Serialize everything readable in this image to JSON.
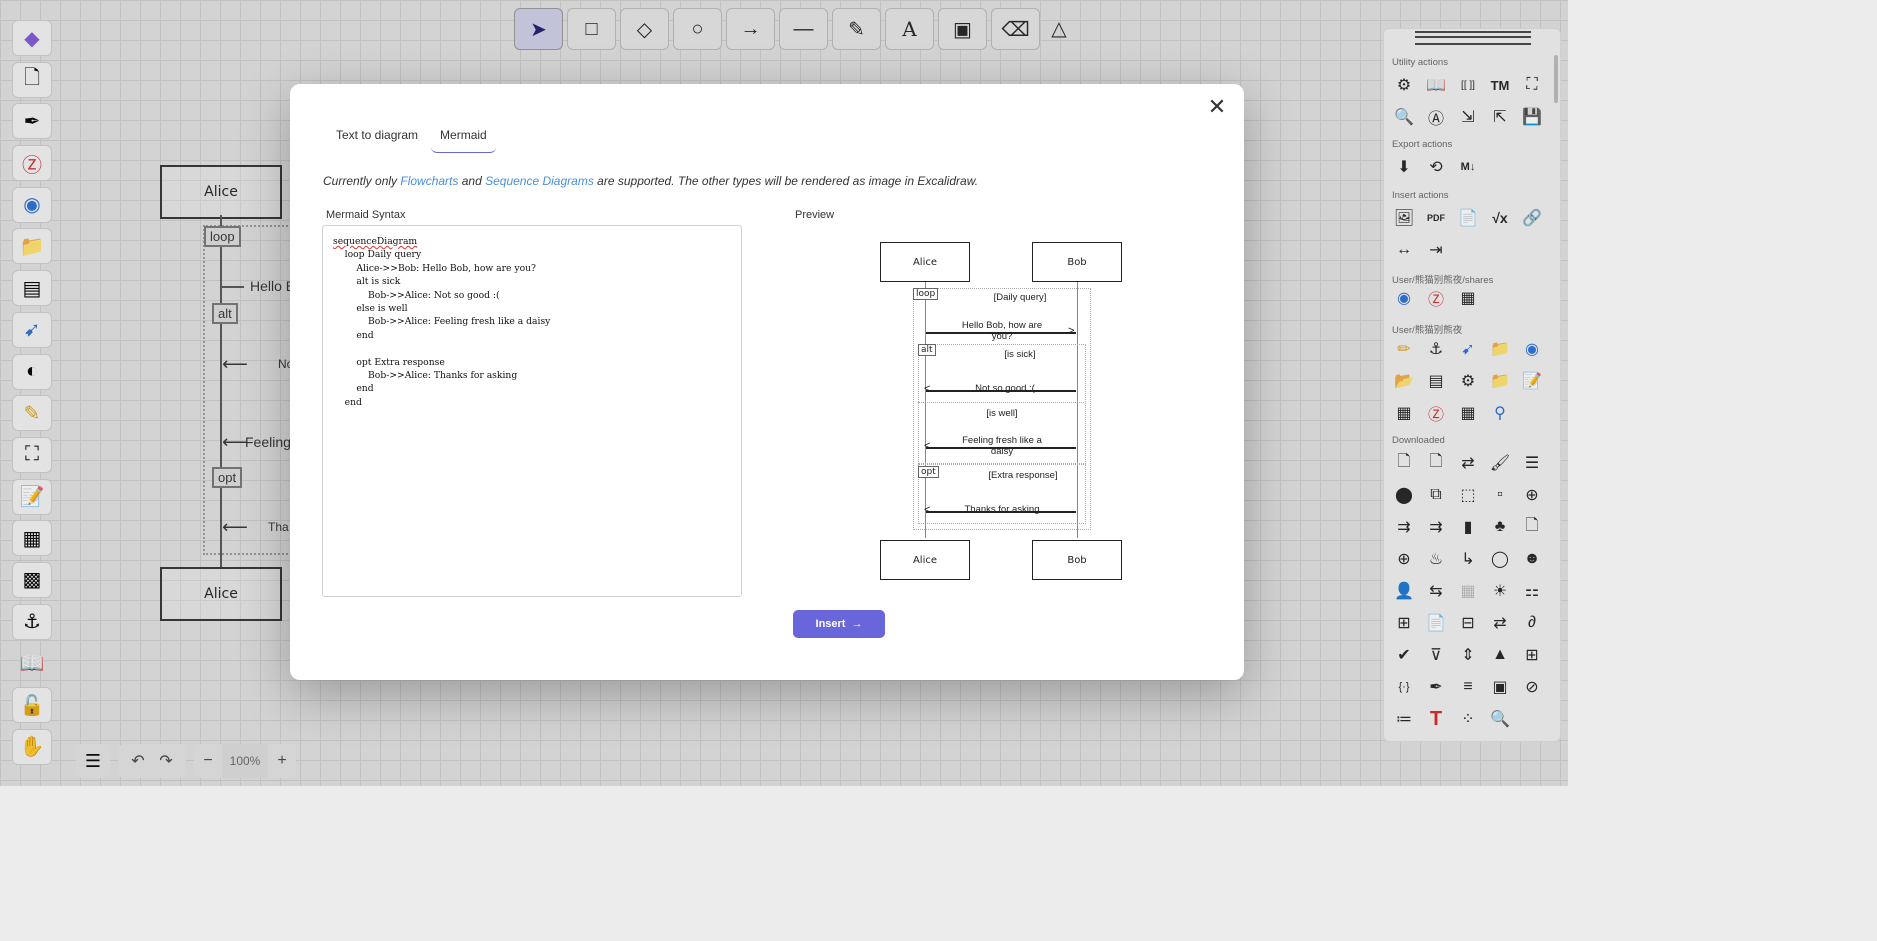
{
  "toolbar": {
    "tools": [
      {
        "name": "selection-tool",
        "glyph": "➤"
      },
      {
        "name": "rectangle-tool",
        "glyph": "□"
      },
      {
        "name": "diamond-tool",
        "glyph": "◇"
      },
      {
        "name": "ellipse-tool",
        "glyph": "○"
      },
      {
        "name": "arrow-tool",
        "glyph": "→"
      },
      {
        "name": "line-tool",
        "glyph": "—"
      },
      {
        "name": "draw-tool",
        "glyph": "✎"
      },
      {
        "name": "text-tool",
        "glyph": "A"
      },
      {
        "name": "image-tool",
        "glyph": "▣"
      },
      {
        "name": "eraser-tool",
        "glyph": "⌫"
      }
    ],
    "more_glyph": "△"
  },
  "bottom": {
    "menu_glyph": "☰",
    "undo_glyph": "↶",
    "redo_glyph": "↷",
    "zoom_out": "−",
    "zoom_value": "100%",
    "zoom_in": "+"
  },
  "background": {
    "actor_top": "Alice",
    "actor_bottom": "Alice",
    "loop_tag": "loop",
    "alt_tag": "alt",
    "opt_tag": "opt",
    "msg1": "Hello B",
    "msg2": "No",
    "msg3": "Feeling",
    "msg4": "Tha"
  },
  "right_panel": {
    "sections": {
      "utility": "Utility actions",
      "export": "Export actions",
      "insert": "Insert actions",
      "user_shares": "User/熊猫别熊夜/shares",
      "user": "User/熊猫别熊夜",
      "downloaded": "Downloaded"
    },
    "utility_icons": [
      "gear-icon",
      "book-icon",
      "brackets-icon",
      "tm-icon",
      "fullscreen-icon",
      "search-icon",
      "ocr-icon",
      "import-icon",
      "export-file-icon",
      "save-icon"
    ],
    "utility_glyphs": [
      "⚙",
      "📖",
      "[[ ]]",
      "TM",
      "⛶",
      "🔍",
      "Ⓐ",
      "⇲",
      "⇱",
      "💾"
    ],
    "export_glyphs": [
      "⬇",
      "⟲",
      "M↓"
    ],
    "insert_glyphs": [
      "🖼",
      "PDF",
      "📄",
      "√x",
      "🔗",
      "↔",
      "⇥"
    ],
    "shares_glyphs": [
      "◉",
      "Ⓩ",
      "▦"
    ],
    "user_glyphs": [
      "✏",
      "⚓",
      "➹",
      "📁",
      "◉",
      "📂",
      "▤",
      "⚙",
      "📁",
      "📝",
      "▦",
      "Ⓩ",
      "▦",
      "⚲"
    ],
    "downloaded_glyphs": [
      "🗋",
      "🗋",
      "⇄",
      "🖌",
      "☰",
      "⬤",
      "⧉",
      "⬚",
      "▫",
      "⊕",
      "⇉",
      "⇉",
      "▮",
      "♣",
      "🗋",
      "⊕",
      "♨",
      "↳",
      "◯",
      "☻",
      "👤",
      "⇆",
      "▦",
      "☀",
      "⚏",
      "⊞",
      "📄",
      "⊟",
      "⇄",
      "∂",
      "✔",
      "⊽",
      "⇕",
      "▲",
      "⊞",
      "{·}",
      "✒",
      "≡",
      "▣",
      "⊘",
      "≔",
      "T",
      "⁘",
      "🔍"
    ]
  },
  "left_sidebar": {
    "icons": [
      "obsidian-icon",
      "new-drawing-icon",
      "pen-icon",
      "zotero-icon",
      "globe-icon",
      "folder-icon",
      "table-icon",
      "bird-icon",
      "layers-icon",
      "pencil-icon",
      "frame-icon",
      "notes-icon",
      "gallery-icon",
      "settings-image-icon",
      "anchor-icon",
      "book-icon",
      "unlock-icon",
      "hand-icon"
    ],
    "glyphs": [
      "◆",
      "🗋",
      "✒",
      "Ⓩ",
      "◉",
      "📁",
      "▤",
      "➹",
      "◐",
      "✎",
      "⛶",
      "📝",
      "▦",
      "▩",
      "⚓",
      "📖",
      "🔓",
      "✋"
    ]
  },
  "modal": {
    "tabs": [
      "Text to diagram",
      "Mermaid"
    ],
    "active_tab": "Mermaid",
    "note_prefix": "Currently only ",
    "note_link1": "Flowcharts",
    "note_mid": " and ",
    "note_link2": "Sequence Diagrams",
    "note_suffix": " are supported. The other types will be rendered as image in Excalidraw.",
    "syntax_label": "Mermaid Syntax",
    "preview_label": "Preview",
    "code_first": "sequenceDiagram",
    "code_rest": "\n    loop Daily query\n        Alice->>Bob: Hello Bob, how are you?\n        alt is sick\n            Bob->>Alice: Not so good :(\n        else is well\n            Bob->>Alice: Feeling fresh like a daisy\n        end\n\n        opt Extra response\n            Bob->>Alice: Thanks for asking\n        end\n    end",
    "insert_label": "Insert",
    "insert_arrow": "→",
    "close_glyph": "✕"
  },
  "preview": {
    "actor_a": "Alice",
    "actor_b": "Bob",
    "loop_tag": "loop",
    "loop_label": "[Daily query]",
    "msg1": "Hello Bob, how are you?",
    "alt_tag": "alt",
    "alt_label": "[is sick]",
    "msg2": "Not so good :(",
    "else_label": "[is well]",
    "msg3": "Feeling fresh like a daisy",
    "opt_tag": "opt",
    "opt_label": "[Extra response]",
    "msg4": "Thanks for asking"
  }
}
